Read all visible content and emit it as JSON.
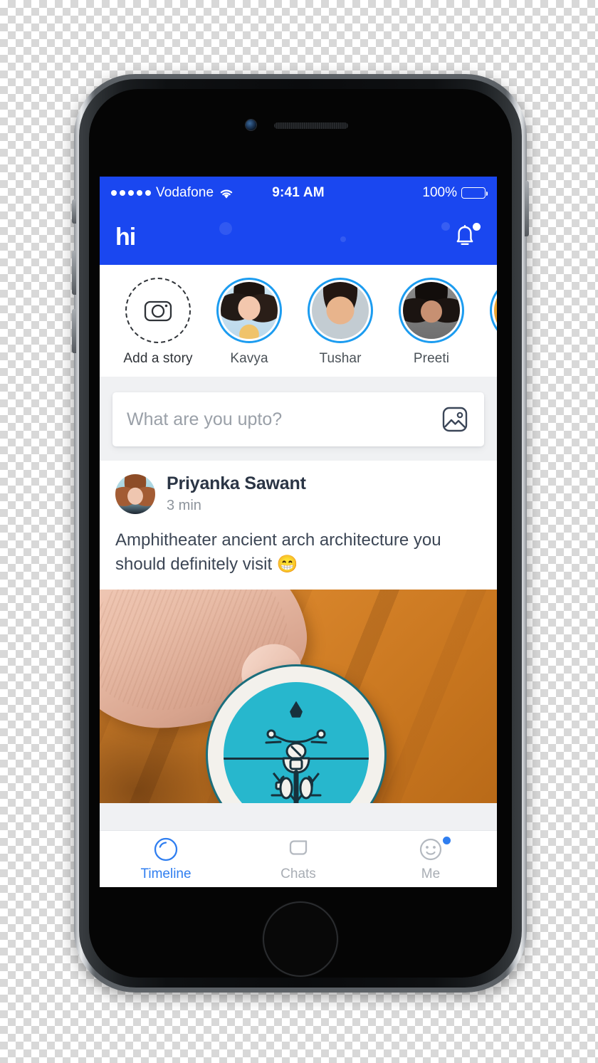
{
  "status_bar": {
    "carrier": "Vodafone",
    "signal_dots": 5,
    "wifi_icon": "wifi-icon",
    "time": "9:41 AM",
    "battery_percent": "100%",
    "battery_icon": "battery-full-icon"
  },
  "nav_bar": {
    "logo_text": "hi",
    "bell_icon": "bell-icon",
    "has_notification_badge": true
  },
  "stories": {
    "items": [
      {
        "label": "Add a story",
        "type": "add",
        "icon": "camera-icon",
        "has_ring": false
      },
      {
        "label": "Kavya",
        "type": "story",
        "has_ring": true
      },
      {
        "label": "Tushar",
        "type": "story",
        "has_ring": true
      },
      {
        "label": "Preeti",
        "type": "story",
        "has_ring": true
      },
      {
        "label": "",
        "type": "story",
        "has_ring": true
      }
    ]
  },
  "composer": {
    "placeholder": "What are you upto?",
    "value": "",
    "image_icon": "image-icon"
  },
  "post": {
    "author": "Priyanka Sawant",
    "timestamp": "3 min",
    "text": "Amphitheater ancient arch architecture you should definitely visit ",
    "emoji": "😁",
    "photo_alt": "finger-holding-motorcycle-pin-badge"
  },
  "tab_bar": {
    "tabs": [
      {
        "label": "Timeline",
        "icon": "timeline-icon",
        "active": true,
        "badge": false
      },
      {
        "label": "Chats",
        "icon": "chat-bubble-icon",
        "active": false,
        "badge": false
      },
      {
        "label": "Me",
        "icon": "smiley-face-icon",
        "active": false,
        "badge": true
      }
    ]
  },
  "colors": {
    "brand_blue": "#1a47f0",
    "accent_blue": "#2f7ef0",
    "story_ring": "#1c9cf0",
    "badge_teal": "#27b7cd",
    "screen_bg": "#f0f1f3"
  }
}
